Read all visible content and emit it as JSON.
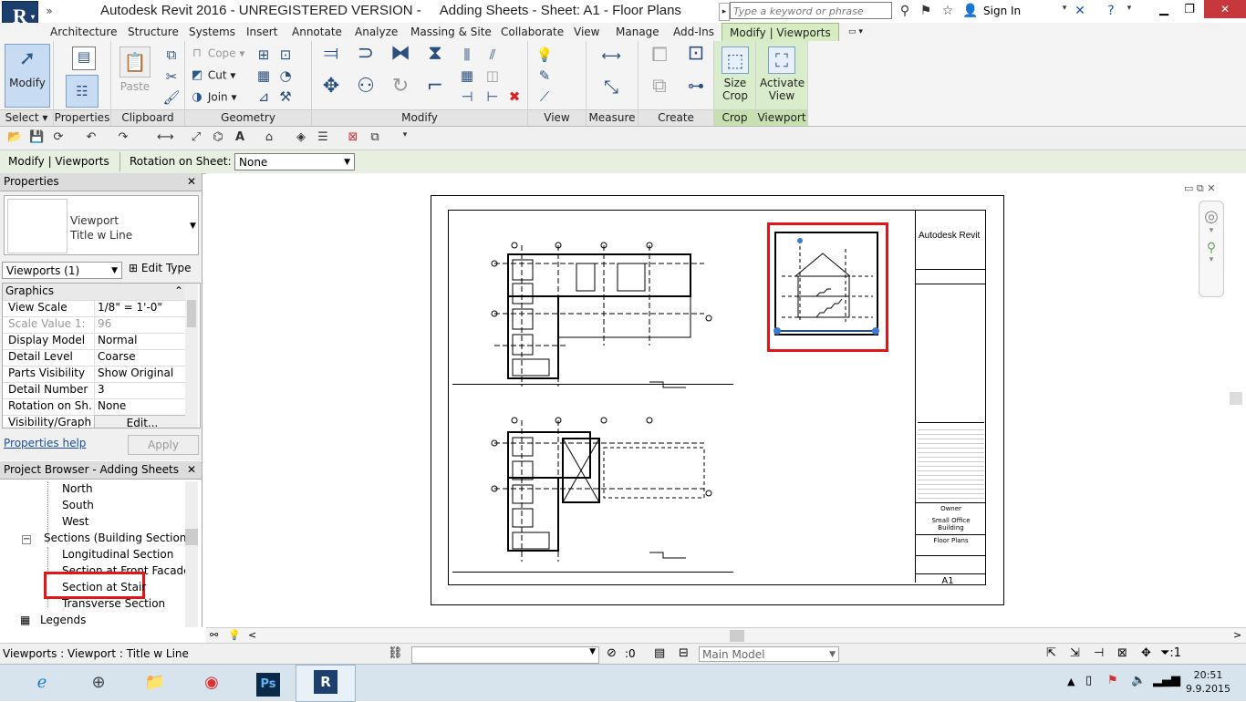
{
  "app": {
    "logo": "R",
    "title": "Autodesk Revit 2016 - UNREGISTERED VERSION -     Adding Sheets - Sheet: A1 - Floor Plans",
    "search_placeholder": "Type a keyword or phrase",
    "sign_in": "Sign In"
  },
  "tabs": [
    "Architecture",
    "Structure",
    "Systems",
    "Insert",
    "Annotate",
    "Analyze",
    "Massing & Site",
    "Collaborate",
    "View",
    "Manage",
    "Add-Ins",
    "Modify | Viewports"
  ],
  "ribbon": {
    "select": {
      "modify": "Modify",
      "label": "Select ▾"
    },
    "properties_label": "Properties",
    "clipboard": {
      "paste": "Paste",
      "label": "Clipboard"
    },
    "geometry": {
      "cope": "Cope",
      "cut": "Cut",
      "join": "Join",
      "label": "Geometry"
    },
    "modify_label": "Modify",
    "view_label": "View",
    "measure_label": "Measure",
    "create_label": "Create",
    "crop": {
      "size_crop_1": "Size",
      "size_crop_2": "Crop",
      "label": "Crop"
    },
    "viewport": {
      "activate_1": "Activate",
      "activate_2": "View",
      "label": "Viewport"
    }
  },
  "options_bar": {
    "context": "Modify | Viewports",
    "rotation_label": "Rotation on Sheet:",
    "rotation_value": "None"
  },
  "properties": {
    "title": "Properties",
    "type_line1": "Viewport",
    "type_line2": "Title w Line",
    "instance_selector": "Viewports (1)",
    "edit_type": "Edit Type",
    "category": "Graphics",
    "rows": [
      {
        "k": "View Scale",
        "v": "1/8\" = 1'-0\""
      },
      {
        "k": "Scale Value    1:",
        "v": "96"
      },
      {
        "k": "Display Model",
        "v": "Normal"
      },
      {
        "k": "Detail Level",
        "v": "Coarse"
      },
      {
        "k": "Parts Visibility",
        "v": "Show Original"
      },
      {
        "k": "Detail Number",
        "v": "3"
      },
      {
        "k": "Rotation on Sh...",
        "v": "None"
      },
      {
        "k": "Visibility/Graph...",
        "v": "Edit..."
      }
    ],
    "help": "Properties help",
    "apply": "Apply"
  },
  "browser": {
    "title": "Project Browser - Adding Sheets",
    "items": [
      "North",
      "South",
      "West",
      "Sections (Building Section)",
      "Longitudinal Section",
      "Section at Front Facade",
      "Section at Stair",
      "Transverse Section",
      "Legends"
    ]
  },
  "sheet": {
    "company": "Autodesk Revit",
    "owner": "Owner",
    "project_1": "Small Office",
    "project_2": "Building",
    "sheet_name": "Floor Plans",
    "sheet_number": "A1"
  },
  "status": {
    "text": "Viewports : Viewport : Title w Line",
    "count": ":0",
    "model": "Main Model"
  },
  "clock": {
    "time": "20:51",
    "date": "9.9.2015"
  },
  "colors": {
    "highlight": "#e21616",
    "context_tab": "#d7ecc2",
    "app_blue": "#1d3f6e"
  }
}
